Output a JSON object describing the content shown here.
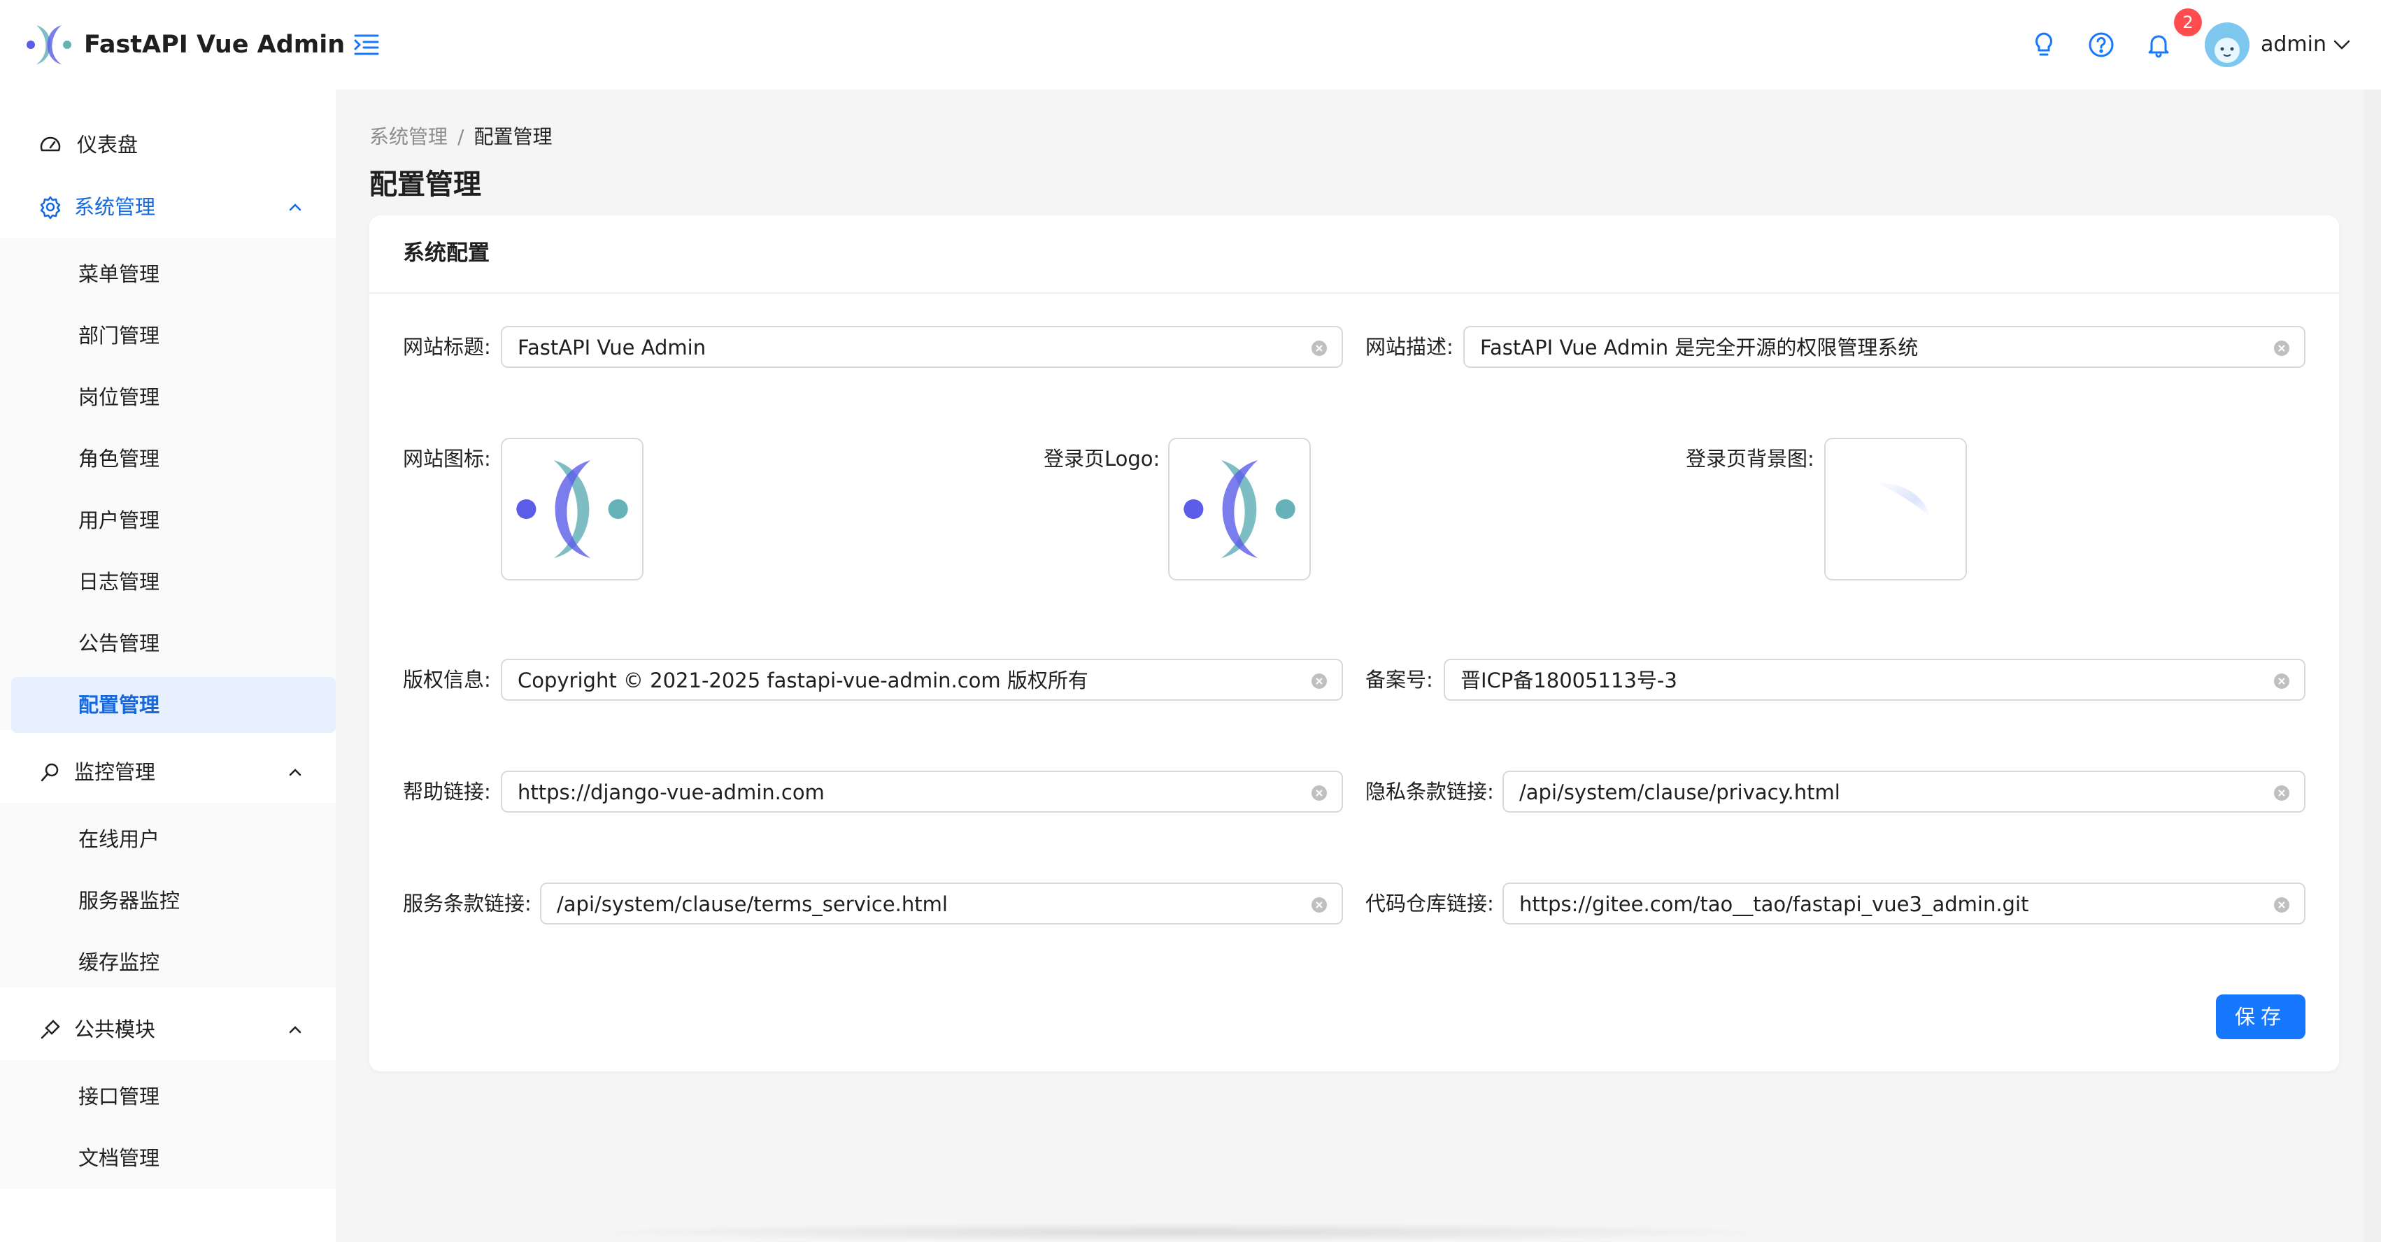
{
  "header": {
    "app_title": "FastAPI Vue Admin",
    "notification_count": "2",
    "user_name": "admin",
    "icons": [
      "lightbulb-icon",
      "help-icon",
      "bell-icon"
    ]
  },
  "sidebar": {
    "items": [
      {
        "label": "仪表盘",
        "icon": "dashboard-icon"
      },
      {
        "label": "系统管理",
        "icon": "gear-icon",
        "open": true,
        "children": [
          "菜单管理",
          "部门管理",
          "岗位管理",
          "角色管理",
          "用户管理",
          "日志管理",
          "公告管理",
          "配置管理"
        ]
      },
      {
        "label": "监控管理",
        "icon": "monitor-icon",
        "open": true,
        "children": [
          "在线用户",
          "服务器监控",
          "缓存监控"
        ]
      },
      {
        "label": "公共模块",
        "icon": "module-icon",
        "open": true,
        "children": [
          "接口管理",
          "文档管理"
        ]
      }
    ],
    "active_child": "配置管理"
  },
  "breadcrumb": {
    "parent": "系统管理",
    "separator": "/",
    "current": "配置管理"
  },
  "page_title": "配置管理",
  "card": {
    "title": "系统配置",
    "fields": {
      "site_title": {
        "label": "网站标题:",
        "value": "FastAPI Vue Admin"
      },
      "site_desc": {
        "label": "网站描述:",
        "value": "FastAPI Vue Admin 是完全开源的权限管理系统"
      },
      "site_icon": {
        "label": "网站图标:"
      },
      "login_logo": {
        "label": "登录页Logo:"
      },
      "login_bg": {
        "label": "登录页背景图:"
      },
      "copyright": {
        "label": "版权信息:",
        "value": "Copyright © 2021-2025 fastapi-vue-admin.com 版权所有"
      },
      "icp": {
        "label": "备案号:",
        "value": "晋ICP备18005113号-3"
      },
      "help_link": {
        "label": "帮助链接:",
        "value": "https://django-vue-admin.com"
      },
      "privacy_link": {
        "label": "隐私条款链接:",
        "value": "/api/system/clause/privacy.html"
      },
      "terms_link": {
        "label": "服务条款链接:",
        "value": "/api/system/clause/terms_service.html"
      },
      "repo_link": {
        "label": "代码仓库链接:",
        "value": "https://gitee.com/tao__tao/fastapi_vue3_admin.git"
      }
    },
    "save_label": "保存"
  },
  "colors": {
    "primary": "#1677ff",
    "active_bg": "#e6f0ff",
    "logo_blue": "#5b5ce8",
    "logo_teal": "#66b2b8"
  }
}
